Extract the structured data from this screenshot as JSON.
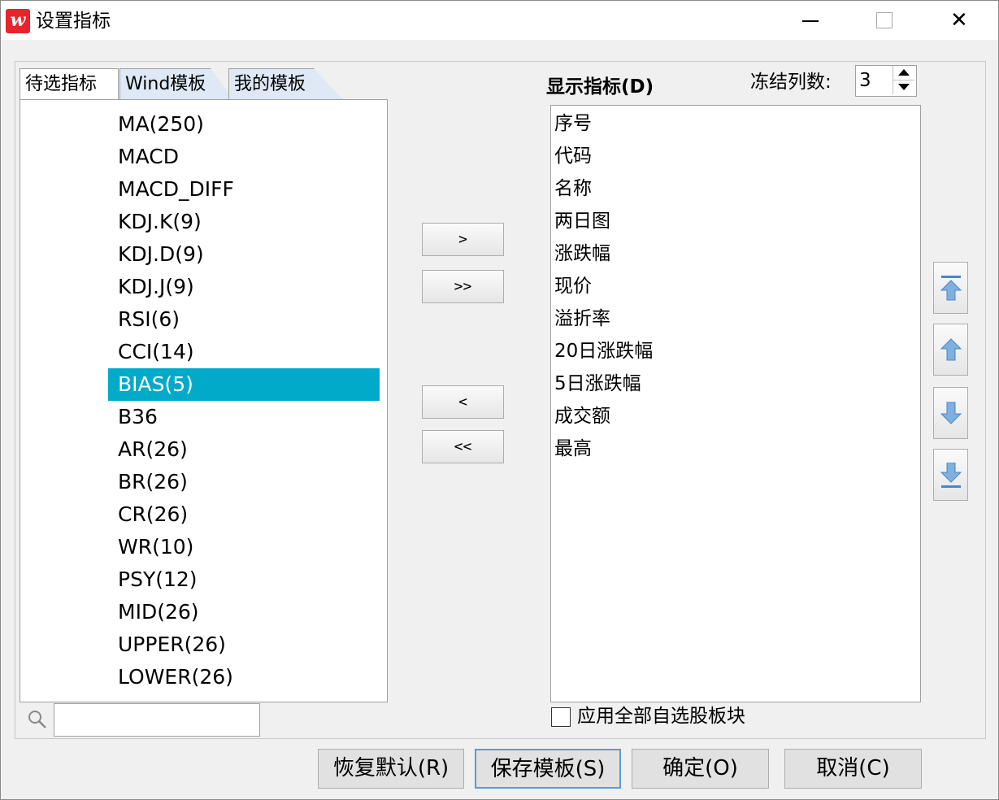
{
  "window": {
    "title": "设置指标",
    "icon": "wind-logo-icon"
  },
  "tabs": [
    {
      "label": "待选指标",
      "active": true
    },
    {
      "label": "Wind模板",
      "active": false
    },
    {
      "label": "我的模板",
      "active": false
    }
  ],
  "available_list": {
    "items": [
      "MA(250)",
      "MACD",
      "MACD_DIFF",
      "KDJ.K(9)",
      "KDJ.D(9)",
      "KDJ.J(9)",
      "RSI(6)",
      "CCI(14)",
      "BIAS(5)",
      "B36",
      "AR(26)",
      "BR(26)",
      "CR(26)",
      "WR(10)",
      "PSY(12)",
      "MID(26)",
      "UPPER(26)",
      "LOWER(26)"
    ],
    "selected": "BIAS(5)"
  },
  "search": {
    "value": "",
    "icon": "search-icon"
  },
  "move_buttons": {
    "add": ">",
    "add_all": ">>",
    "remove": "<",
    "remove_all": "<<"
  },
  "display": {
    "header": "显示指标(D)",
    "freeze_label": "冻结列数:",
    "freeze_value": "3",
    "items": [
      "序号",
      "代码",
      "名称",
      "两日图",
      "涨跌幅",
      "现价",
      "溢折率",
      "20日涨跌幅",
      "5日涨跌幅",
      "成交额",
      "最高"
    ]
  },
  "order_buttons": [
    "move-top-icon",
    "move-up-icon",
    "move-down-icon",
    "move-bottom-icon"
  ],
  "apply_all": {
    "label": "应用全部自选股板块",
    "checked": false
  },
  "buttons": {
    "restore": "恢复默认(R)",
    "save_template": "保存模板(S)",
    "ok": "确定(O)",
    "cancel": "取消(C)"
  },
  "colors": {
    "selection": "#00aac8",
    "app_icon": "#e8232c",
    "focus_border": "#5b9bd5"
  }
}
